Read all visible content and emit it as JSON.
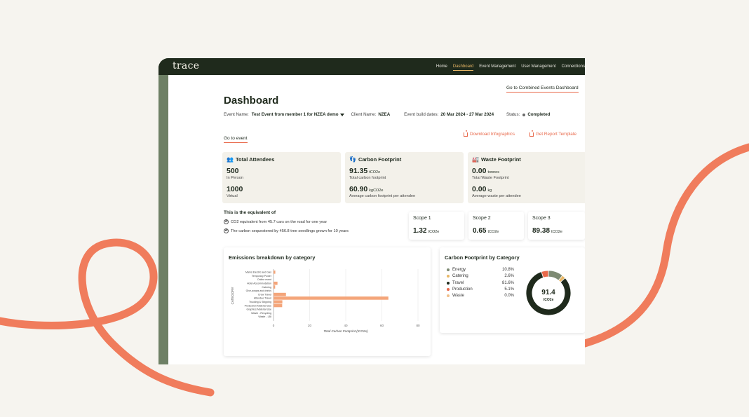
{
  "brand": {
    "logo": "trace",
    "accent": "#e8684a",
    "dark": "#1f2a1c",
    "gold": "#e8b766"
  },
  "nav": {
    "items": [
      {
        "label": "Home",
        "active": false
      },
      {
        "label": "Dashboard",
        "active": true
      },
      {
        "label": "Event Management",
        "active": false
      },
      {
        "label": "User Management",
        "active": false
      },
      {
        "label": "Connections",
        "active": false
      }
    ]
  },
  "header": {
    "combined_link": "Go to Combined Events Dashboard",
    "title": "Dashboard",
    "event_name_label": "Event Name:",
    "event_name_value": "Test Event from member 1 for NZEA demo",
    "client_label": "Client Name:",
    "client_value": "NZEA",
    "dates_label": "Event build dates:",
    "dates_value": "20 Mar 2024 - 27 Mar 2024",
    "status_label": "Status:",
    "status_value": "Completed",
    "goto_event": "Go to event",
    "download_infographics": "Download Infographics",
    "report_template": "Get Report Template"
  },
  "cards": {
    "attendees": {
      "icon": "people-icon",
      "title": "Total Attendees",
      "v1": "500",
      "l1": "In Person",
      "v2": "1000",
      "l2": "Virtual"
    },
    "carbon": {
      "icon": "footprint-icon",
      "title": "Carbon Footprint",
      "v1": "91.35",
      "u1": "tCO2e",
      "l1": "Total carbon footprint",
      "v2": "60.90",
      "u2": "kgCO2e",
      "l2": "Average carbon footprint per attendee"
    },
    "waste": {
      "icon": "factory-icon",
      "title": "Waste Footprint",
      "v1": "0.00",
      "u1": "tonnes",
      "l1": "Total Waste Footprint",
      "v2": "0.00",
      "u2": "kg",
      "l2": "Average waste per attendee"
    }
  },
  "equivalent": {
    "title": "This is the equivalent of",
    "line1": "CO2 equivalent from 45.7 cars on the road for one year",
    "line2": "The carbon sequestered by 456.8 tree seedlings grown for 10 years"
  },
  "scopes": [
    {
      "label": "Scope 1",
      "value": "1.32",
      "unit": "tCO2e"
    },
    {
      "label": "Scope 2",
      "value": "0.65",
      "unit": "tCO2e"
    },
    {
      "label": "Scope 3",
      "value": "89.38",
      "unit": "tCO2e"
    }
  ],
  "chart_data": [
    {
      "type": "bar",
      "orientation": "horizontal",
      "title": "Emissions breakdown by category",
      "xlabel": "Total Carbon Footprint (tCO2e)",
      "ylabel": "CATEGORY",
      "xlim": [
        0,
        80
      ],
      "xticks": [
        "0",
        "20",
        "40",
        "60",
        "80"
      ],
      "categories": [
        "Mains Electric and Gas",
        "Temporary Power",
        "Online event",
        "Hotel Accommodation",
        "Catering",
        "Give-aways and drinks",
        "Crew Travel",
        "Attendee Travel",
        "Trucking & Shipping",
        "Production Material Use",
        "Graphics Material Use",
        "Waste - Recycling",
        "Waste - LBI"
      ],
      "values": [
        1.0,
        0,
        0,
        2.2,
        0.9,
        0,
        6.9,
        63.6,
        4.9,
        4.8,
        0,
        0,
        0
      ],
      "color": "#f4a57a"
    },
    {
      "type": "pie",
      "donut": true,
      "title": "Carbon Footprint by Category",
      "center_value": "91.4",
      "center_unit": "tCO2e",
      "series": [
        {
          "name": "Energy",
          "pct": "10.8%",
          "value": 10.8,
          "color": "#7d8a73"
        },
        {
          "name": "Catering",
          "pct": "2.6%",
          "value": 2.6,
          "color": "#e8b766"
        },
        {
          "name": "Travel",
          "pct": "81.6%",
          "value": 81.6,
          "color": "#1f2a1c"
        },
        {
          "name": "Production",
          "pct": "5.1%",
          "value": 5.1,
          "color": "#e8684a"
        },
        {
          "name": "Waste",
          "pct": "0.0%",
          "value": 0.0,
          "color": "#f0c08a"
        }
      ]
    }
  ]
}
